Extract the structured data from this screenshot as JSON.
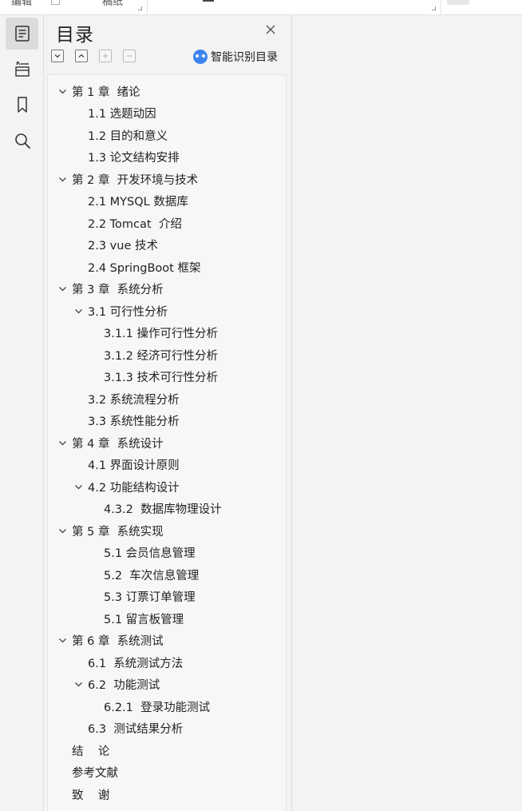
{
  "topbar": {
    "frag1": "编辑",
    "frag2": "稿纸"
  },
  "rail": {
    "items": [
      {
        "name": "outline-panel-button",
        "icon": "document-outline-icon",
        "active": true
      },
      {
        "name": "structure-button",
        "icon": "structure-icon",
        "active": false
      },
      {
        "name": "bookmark-button",
        "icon": "bookmark-icon",
        "active": false
      },
      {
        "name": "search-button",
        "icon": "search-icon",
        "active": false
      }
    ]
  },
  "panel": {
    "title": "目录",
    "smart_label": "智能识别目录",
    "tools": [
      "collapse-icon",
      "expand-icon",
      "add-icon",
      "remove-icon"
    ]
  },
  "outline": [
    {
      "label": "第 1 章  绪论",
      "level": 0,
      "expanded": true
    },
    {
      "label": "1.1 选题动因",
      "level": 1
    },
    {
      "label": "1.2 目的和意义",
      "level": 1
    },
    {
      "label": "1.3 论文结构安排",
      "level": 1
    },
    {
      "label": "第 2 章  开发环境与技术",
      "level": 0,
      "expanded": true
    },
    {
      "label": "2.1 MYSQL 数据库",
      "level": 1
    },
    {
      "label": "2.2 Tomcat  介绍",
      "level": 1
    },
    {
      "label": "2.3 vue 技术",
      "level": 1
    },
    {
      "label": "2.4 SpringBoot 框架",
      "level": 1
    },
    {
      "label": "第 3 章  系统分析",
      "level": 0,
      "expanded": true
    },
    {
      "label": "3.1 可行性分析",
      "level": 1,
      "expanded": true
    },
    {
      "label": "3.1.1 操作可行性分析",
      "level": 2
    },
    {
      "label": "3.1.2 经济可行性分析",
      "level": 2
    },
    {
      "label": "3.1.3 技术可行性分析",
      "level": 2
    },
    {
      "label": "3.2 系统流程分析",
      "level": 1
    },
    {
      "label": "3.3 系统性能分析",
      "level": 1
    },
    {
      "label": "第 4 章  系统设计",
      "level": 0,
      "expanded": true
    },
    {
      "label": "4.1 界面设计原则",
      "level": 1
    },
    {
      "label": "4.2 功能结构设计",
      "level": 1,
      "expanded": true
    },
    {
      "label": "4.3.2  数据库物理设计",
      "level": 2
    },
    {
      "label": "第 5 章  系统实现",
      "level": 0,
      "expanded": true
    },
    {
      "label": "5.1 会员信息管理",
      "level": 2
    },
    {
      "label": "5.2  车次信息管理",
      "level": 2
    },
    {
      "label": "5.3 订票订单管理",
      "level": 2
    },
    {
      "label": "5.1 留言板管理",
      "level": 2
    },
    {
      "label": "第 6 章  系统测试",
      "level": 0,
      "expanded": true
    },
    {
      "label": "6.1  系统测试方法",
      "level": 1
    },
    {
      "label": "6.2  功能测试",
      "level": 1,
      "expanded": true
    },
    {
      "label": "6.2.1  登录功能测试",
      "level": 2
    },
    {
      "label": "6.3  测试结果分析",
      "level": 1
    },
    {
      "label": "结    论",
      "level": 0
    },
    {
      "label": "参考文献",
      "level": 0
    },
    {
      "label": "致    谢",
      "level": 0
    }
  ]
}
